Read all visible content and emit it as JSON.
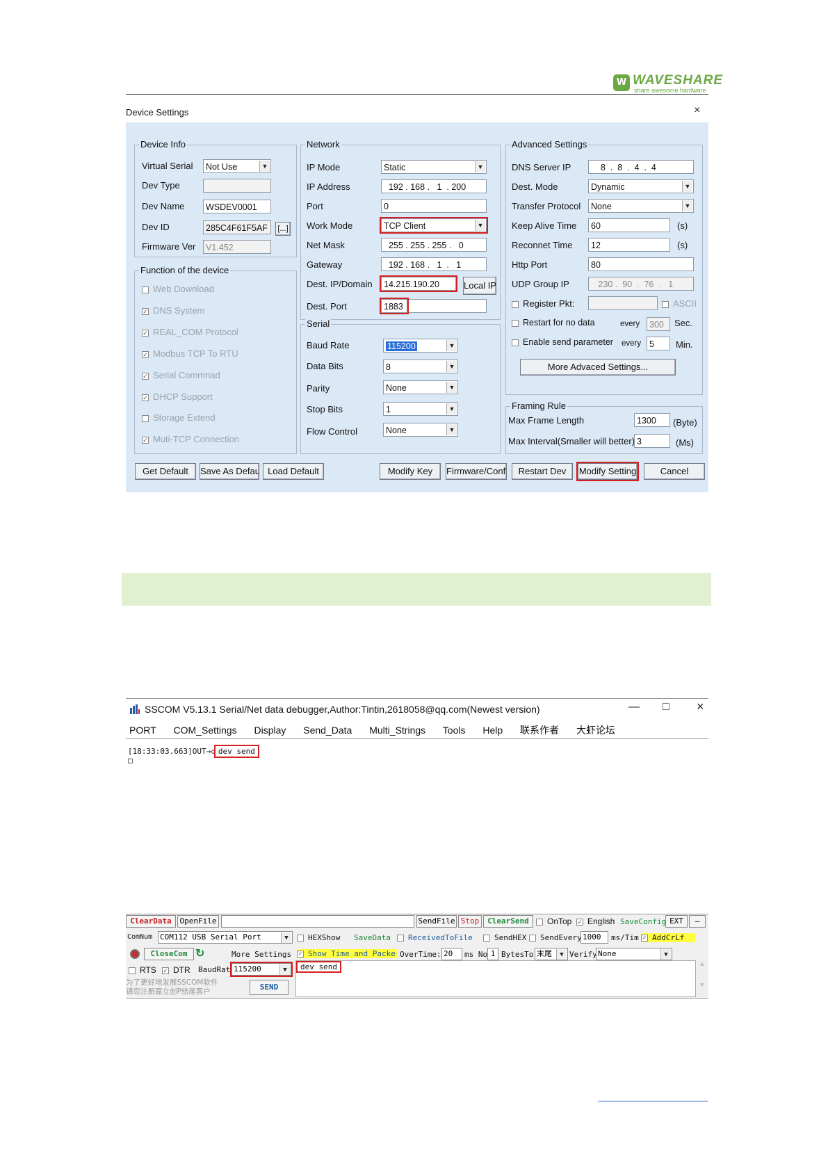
{
  "header": {
    "logo_mark": "W",
    "logo_name": "WAVESHARE",
    "logo_tagline": "share awesome hardware"
  },
  "dialog": {
    "title": "Device Settings",
    "close": "×",
    "device_info": {
      "title": "Device Info",
      "virtual_serial_label": "Virtual Serial",
      "virtual_serial": "Not Use",
      "dev_type_label": "Dev Type",
      "dev_type": "",
      "dev_name_label": "Dev Name",
      "dev_name": "WSDEV0001",
      "dev_id_label": "Dev ID",
      "dev_id": "285C4F61F5AF",
      "dev_id_btn": "[...]",
      "firmware_label": "Firmware Ver",
      "firmware": "V1.452"
    },
    "functions": {
      "title": "Function of the device",
      "items": [
        {
          "label": "Web Download",
          "checked": false
        },
        {
          "label": "DNS System",
          "checked": true
        },
        {
          "label": "REAL_COM Protocol",
          "checked": true
        },
        {
          "label": "Modbus TCP To RTU",
          "checked": true
        },
        {
          "label": "Serial Commnad",
          "checked": true
        },
        {
          "label": "DHCP Support",
          "checked": true
        },
        {
          "label": "Storage Extend",
          "checked": false
        },
        {
          "label": "Muti-TCP Connection",
          "checked": true
        }
      ]
    },
    "network": {
      "title": "Network",
      "ip_mode_label": "IP Mode",
      "ip_mode": "Static",
      "ip_address_label": "IP Address",
      "ip_address": [
        "192",
        "168",
        "1",
        "200"
      ],
      "port_label": "Port",
      "port": "0",
      "work_mode_label": "Work Mode",
      "work_mode": "TCP Client",
      "net_mask_label": "Net Mask",
      "net_mask": [
        "255",
        "255",
        "255",
        "0"
      ],
      "gateway_label": "Gateway",
      "gateway": [
        "192",
        "168",
        "1",
        "1"
      ],
      "dest_ip_label": "Dest. IP/Domain",
      "dest_ip": "14.215.190.20",
      "local_ip_btn": "Local IP",
      "dest_port_label": "Dest. Port",
      "dest_port": "1883"
    },
    "serial": {
      "title": "Serial",
      "baud_label": "Baud Rate",
      "baud": "115200",
      "data_bits_label": "Data Bits",
      "data_bits": "8",
      "parity_label": "Parity",
      "parity": "None",
      "stop_bits_label": "Stop Bits",
      "stop_bits": "1",
      "flow_label": "Flow Control",
      "flow": "None"
    },
    "advanced": {
      "title": "Advanced Settings",
      "dns_label": "DNS Server IP",
      "dns": [
        "8",
        "8",
        "4",
        "4"
      ],
      "dest_mode_label": "Dest. Mode",
      "dest_mode": "Dynamic",
      "transfer_label": "Transfer Protocol",
      "transfer": "None",
      "keepalive_label": "Keep Alive Time",
      "keepalive": "60",
      "keepalive_unit": "(s)",
      "reconnect_label": "Reconnet Time",
      "reconnect": "12",
      "reconnect_unit": "(s)",
      "http_label": "Http Port",
      "http": "80",
      "udp_label": "UDP Group IP",
      "udp": [
        "230",
        "90",
        "76",
        "1"
      ],
      "register_label": "Register Pkt:",
      "ascii_label": "ASCII",
      "restart_label": "Restart for no data",
      "restart_every": "every",
      "restart_value": "300",
      "restart_unit": "Sec.",
      "enable_send_label": "Enable send parameter",
      "enable_every": "every",
      "enable_value": "5",
      "enable_unit": "Min.",
      "more_btn": "More Advaced Settings..."
    },
    "framing": {
      "title": "Framing Rule",
      "max_frame_label": "Max Frame Length",
      "max_frame": "1300",
      "max_frame_unit": "(Byte)",
      "max_interval_label": "Max Interval(Smaller will better)",
      "max_interval": "3",
      "max_interval_unit": "(Ms)"
    },
    "buttons": {
      "get_default": "Get Default",
      "save_default": "Save As Default",
      "load_default": "Load Default",
      "modify_key": "Modify Key",
      "firmware_config": "Firmware/Config",
      "restart_dev": "Restart Dev",
      "modify_setting": "Modify Setting",
      "cancel": "Cancel"
    }
  },
  "sscom": {
    "title": "SSCOM V5.13.1 Serial/Net data debugger,Author:Tintin,2618058@qq.com(Newest version)",
    "window_minimize": "—",
    "window_maximize": "□",
    "window_close": "×",
    "menu": [
      "PORT",
      "COM_Settings",
      "Display",
      "Send_Data",
      "Multi_Strings",
      "Tools",
      "Help",
      "联系作者",
      "大虾论坛"
    ],
    "log_prefix": "[18:33:03.663]OUT→◇",
    "log_sent": "dev send",
    "log_cursor": "□",
    "toolbar": {
      "clear_data": "ClearData",
      "open_file": "OpenFile",
      "send_file": "SendFile",
      "stop": "Stop",
      "clear_send": "ClearSend",
      "ontop": "OnTop",
      "english": "English",
      "save_config": "SaveConfig",
      "ext": "EXT",
      "dash": "—",
      "comnum_label": "ComNum",
      "comnum": "COM112 USB Serial Port",
      "hexshow": "HEXShow",
      "savedata": "SaveData",
      "received_to_file": "ReceivedToFile",
      "sendhex": "SendHEX",
      "sendevery": "SendEvery:",
      "sendevery_value": "1000",
      "ms_tim": "ms/Tim",
      "addcrlf": "AddCrLf",
      "close_com": "CloseCom",
      "more_settings": "More Settings",
      "show_time": "Show Time and Packe",
      "overtime": "OverTime:",
      "overtime_value": "20",
      "ms_no": "ms No",
      "no_value": "1",
      "bytes_to": "BytesTo",
      "bytes_end": "末尾",
      "verify": "Verify",
      "verify_value": "None",
      "rts": "RTS",
      "dtr": "DTR",
      "baudrate": "BaudRat",
      "baud_value": "115200",
      "send_text": "dev send",
      "promo": "为了更好地发展SSCOM软件\n请您注册嘉立创P结尾客户",
      "send_btn": "SEND"
    }
  },
  "colors": {
    "dialog_bg": "#dbe8f5",
    "highlight": "#d42020",
    "brand": "#6aa842",
    "note_bar": "#e0f0d0"
  }
}
